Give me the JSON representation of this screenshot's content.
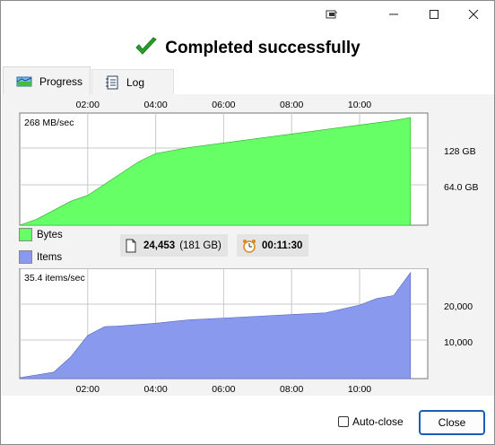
{
  "window": {
    "headline": "Completed successfully",
    "controls": [
      "restore-down",
      "minimize",
      "maximize",
      "close"
    ]
  },
  "tabs": [
    {
      "label": "Progress",
      "active": true,
      "icon": "progress-icon"
    },
    {
      "label": "Log",
      "active": false,
      "icon": "log-icon"
    }
  ],
  "time_ticks": [
    "02:00",
    "04:00",
    "06:00",
    "08:00",
    "10:00"
  ],
  "bytes_chart": {
    "rate_label": "268 MB/sec",
    "y_ticks": [
      "128 GB",
      "64.0 GB"
    ],
    "color": "#66ff66"
  },
  "items_chart": {
    "rate_label": "35.4 items/sec",
    "y_ticks": [
      "20,000",
      "10,000"
    ],
    "color": "#8899ee"
  },
  "legend": [
    {
      "label": "Bytes",
      "color": "#66ff66"
    },
    {
      "label": "Items",
      "color": "#8899ee"
    }
  ],
  "stats": {
    "items_count": "24,453",
    "items_size": "(181 GB)",
    "elapsed": "00:11:30"
  },
  "footer": {
    "autoclose_label": "Auto-close",
    "autoclose_checked": false,
    "close_label": "Close"
  },
  "chart_data": [
    {
      "type": "area",
      "x": [
        "00:30",
        "01:00",
        "01:30",
        "02:00",
        "02:30",
        "03:00",
        "03:30",
        "04:00",
        "05:00",
        "06:00",
        "07:00",
        "08:00",
        "09:00",
        "10:00",
        "11:00",
        "11:30"
      ],
      "series": [
        {
          "name": "Bytes",
          "values": [
            8,
            20,
            32,
            40,
            55,
            70,
            85,
            96,
            104,
            110,
            116,
            122,
            128,
            134,
            140,
            144
          ]
        }
      ],
      "xlabel": "",
      "ylabel": "",
      "ylim": [
        0,
        150
      ]
    },
    {
      "type": "area",
      "x": [
        "00:00",
        "01:00",
        "01:30",
        "02:00",
        "02:30",
        "03:00",
        "04:00",
        "04:30",
        "05:00",
        "06:00",
        "07:00",
        "08:00",
        "09:00",
        "10:00",
        "10:30",
        "11:00",
        "11:30"
      ],
      "series": [
        {
          "name": "Items",
          "values": [
            200,
            1500,
            5000,
            10000,
            12000,
            12200,
            12800,
            13200,
            13600,
            14000,
            14400,
            14800,
            15200,
            17000,
            18500,
            19200,
            24500
          ]
        }
      ],
      "xlabel": "",
      "ylabel": "",
      "ylim": [
        0,
        25500
      ]
    }
  ]
}
